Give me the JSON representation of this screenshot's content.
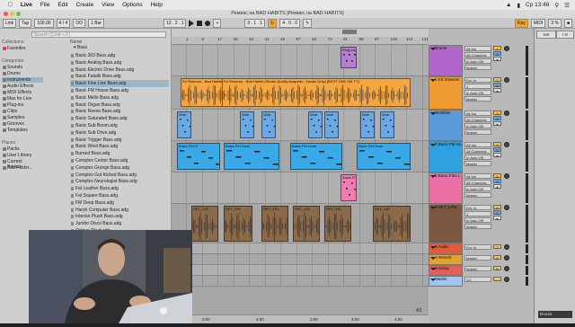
{
  "menubar": {
    "items": [
      "Live",
      "File",
      "Edit",
      "Create",
      "View",
      "Options",
      "Help"
    ],
    "clock": "Cp 13:46"
  },
  "window": {
    "title": "Ремикс на BAD HABITS  [Ремикс на BAD HABITS]"
  },
  "transport": {
    "link": "Link",
    "tap": "Tap",
    "tempo": "100.00",
    "sig": "4 / 4",
    "metro": "OO",
    "quant": "1 Bar",
    "position": "12 . 2 . 1",
    "loop_start": "3 . 1 . 1",
    "loop_len": "4 . 0 . 0",
    "key": "Key",
    "midi": "MIDI",
    "cpu": "3 %"
  },
  "browser": {
    "search_placeholder": "Search (Cmd + F)",
    "collections_header": "Collections",
    "collections": [
      {
        "label": "Favorites",
        "color": "#e04545"
      }
    ],
    "categories_header": "Categories",
    "categories": [
      "Sounds",
      "Drums",
      "Instruments",
      "Audio Effects",
      "MIDI Effects",
      "Max for Live",
      "Plug-ins",
      "Clips",
      "Samples",
      "Grooves",
      "Templates"
    ],
    "selected_category": "Instruments",
    "places_header": "Places",
    "places": [
      "Packs",
      "User Library",
      "Current Project",
      "Add Folder..."
    ],
    "name_header": "Name",
    "folder": "Bass",
    "files": [
      "Basic 303 Bass.adg",
      "Basic Analog Bass.adg",
      "Basic Electric Drive Bass.adg",
      "Basic Fatalik Bass.adg",
      "Basic Fine Line Bass.adg",
      "Basic FM House Bass.adg",
      "Basic Mello Bass.adg",
      "Basic Organ Bass.adg",
      "Basic Reese Bass.adg",
      "Basic Saturated Bass.adg",
      "Basic Sub Boom.adg",
      "Basic Sub Drive.adg",
      "Basic Trigger Bass.adg",
      "Basic Wool Bass.adg",
      "Burned Bass.adg",
      "Complex Center Bass.adg",
      "Complex Grunge Bass.adg",
      "Complex Gut Kicked Bass.adg",
      "Complex Neurologist Bass.adg",
      "Fat Leather Bass.adg",
      "Fat Square Bass.adg",
      "FM Deep Bass.adg",
      "Harsh Computer Bass.adg",
      "Intense Plush Bass.adg",
      "Jumbo Disco Bass.adg",
      "Octave Thud.adg"
    ],
    "selected_file": "Basic Fine Line Bass.adg"
  },
  "arrangement": {
    "ruler": [
      "1",
      "9",
      "17",
      "25",
      "33",
      "41",
      "49",
      "57",
      "65",
      "73",
      "81",
      "89",
      "97",
      "105",
      "113",
      "121"
    ],
    "timeline": [
      "0:00",
      "1:00",
      "2:00",
      "3:00",
      "4:00"
    ],
    "time_sig_footer": "4/1"
  },
  "tracks": [
    {
      "name": "Drums",
      "color": "#b366c9",
      "clip_color": "#b57fd0",
      "io": [
        "All Ins",
        "All Channels",
        "In Auto Off",
        "Master"
      ],
      "number": "1",
      "clips": [
        {
          "label": "Drum Rack"
        },
        {
          "label": "Plug-Ins"
        }
      ]
    },
    {
      "name": "4 Ed Sheeran",
      "color": "#f09a32",
      "clip_color": "#f4a643",
      "io": [
        "Ext. In",
        "1",
        "In Auto Off",
        "Master"
      ],
      "number": "2",
      "clips": [
        {
          "label": "Ed Sheeran - Bad Habits"
        },
        {
          "label": "Ed Sheeran - Bad Habits (Studio Quality Acapella - Vocals Only) [BEST ONE ON YT]"
        }
      ]
    },
    {
      "name": "Wobbles",
      "color": "#5a9ad8",
      "clip_color": "#6aa8e6",
      "io": [
        "All Ins",
        "All Channels",
        "In Auto Off",
        "Master"
      ],
      "number": "3",
      "clips": [
        {
          "label": "Wob"
        }
      ]
    },
    {
      "name": "7 Basic FM Ho",
      "color": "#2fa0e0",
      "clip_color": "#39a9e8",
      "io": [
        "All Ins",
        "All Channels",
        "In Auto Off",
        "Master"
      ],
      "number": "4",
      "clips": [
        {
          "label": "Basic FM H"
        },
        {
          "label": "Basic FM Hous"
        }
      ]
    },
    {
      "name": "8 Basic Fine L",
      "color": "#ec6fa6",
      "clip_color": "#f07db0",
      "io": [
        "All Ins",
        "All Channels",
        "In Auto Off",
        "Master"
      ],
      "number": "5",
      "clips": [
        {
          "label": "Basic Fi"
        }
      ]
    },
    {
      "name": "9 SKT_LIFE",
      "color": "#7a5840",
      "clip_color": "#8b6a4a",
      "io": [
        "Ext. In",
        "1",
        "In Auto Off",
        "Master"
      ],
      "number": "6",
      "clips": [
        {
          "label": "SKT_130"
        }
      ]
    },
    {
      "name": "5 Audio",
      "color": "#e55a3a",
      "clip_color": "#e55a3a",
      "io": [
        "Ext. In",
        "1",
        "In Auto Off",
        "Master"
      ],
      "number": "7",
      "clips": []
    },
    {
      "name": "A Reverb",
      "color": "#e6a12a",
      "clip_color": "#e6a12a",
      "io": [
        "Master"
      ],
      "number": "A",
      "clips": []
    },
    {
      "name": "B Delay",
      "color": "#e45f5a",
      "clip_color": "#e45f5a",
      "io": [
        "Master"
      ],
      "number": "B",
      "clips": []
    },
    {
      "name": "Master",
      "color": "#9fc6f0",
      "clip_color": "#9fc6f0",
      "io": [
        "1/2"
      ],
      "number": "",
      "clips": []
    }
  ],
  "strip": {
    "set_label": "Set",
    "io_label": "I O"
  },
  "bottom": {
    "groove": "Drums"
  }
}
